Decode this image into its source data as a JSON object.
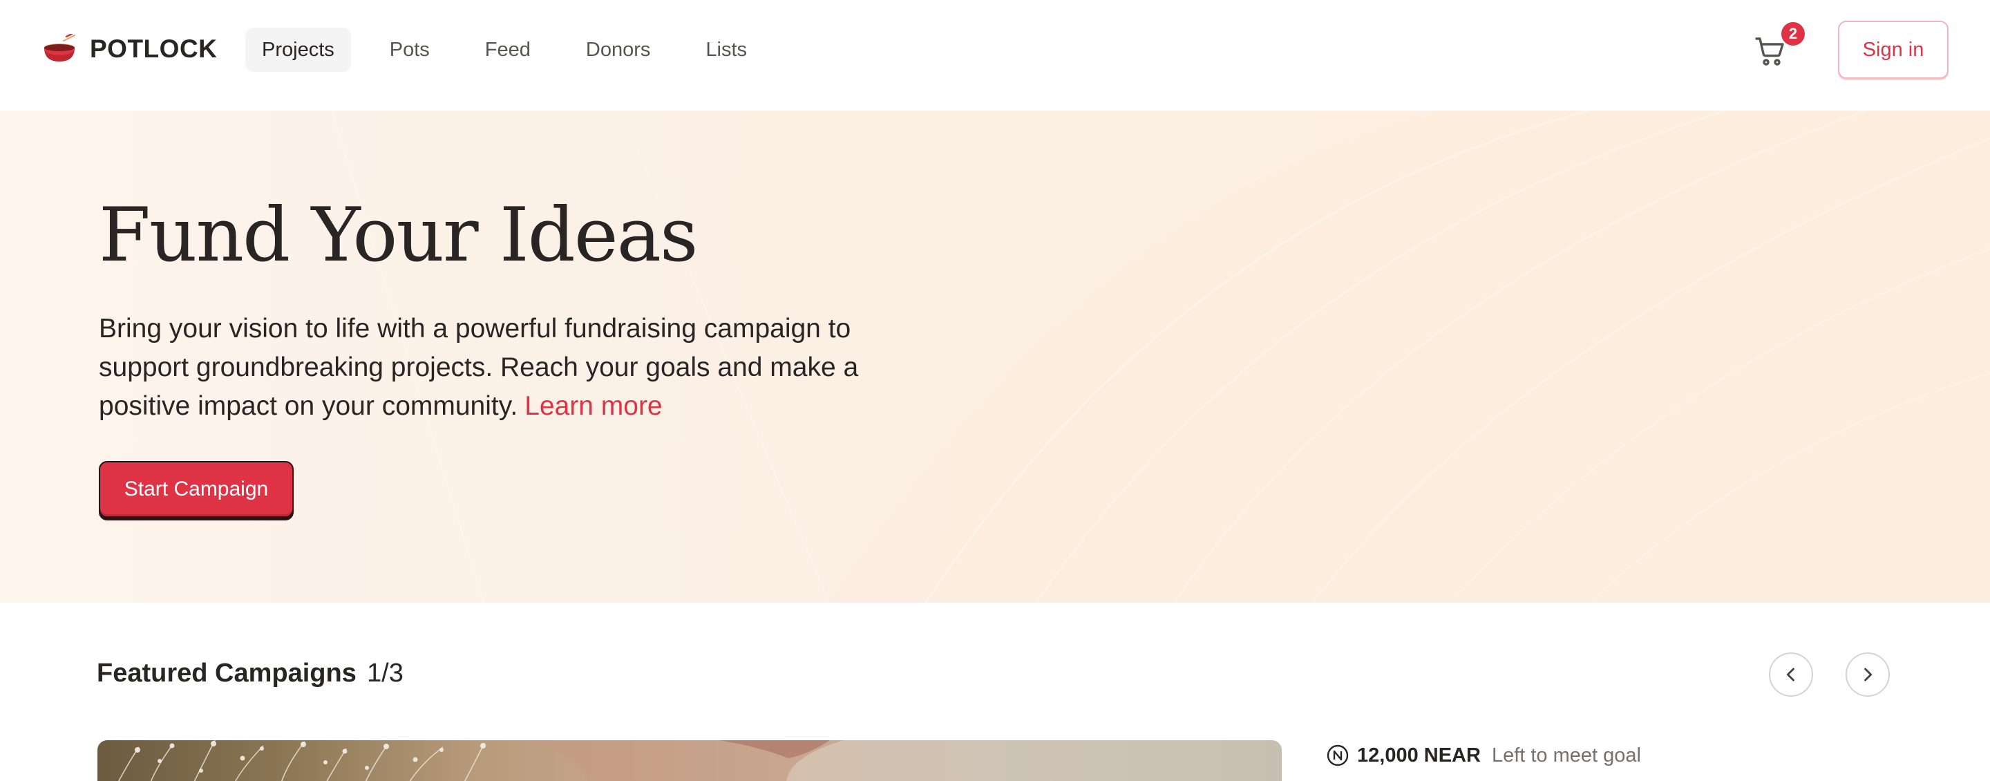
{
  "header": {
    "brand": "POTLOCK",
    "logo_icon": "pot-icon",
    "nav": [
      {
        "label": "Projects",
        "active": true
      },
      {
        "label": "Pots",
        "active": false
      },
      {
        "label": "Feed",
        "active": false
      },
      {
        "label": "Donors",
        "active": false
      },
      {
        "label": "Lists",
        "active": false
      }
    ],
    "cart": {
      "icon": "cart-icon",
      "count": "2"
    },
    "signin_label": "Sign in"
  },
  "hero": {
    "title": "Fund Your Ideas",
    "description": "Bring your vision to life with a powerful fundraising campaign to support groundbreaking projects. Reach your goals and make a positive impact on your community.",
    "learn_more": "Learn more",
    "cta_label": "Start Campaign"
  },
  "featured": {
    "title": "Featured Campaigns",
    "counter": "1/3",
    "prev_icon": "chevron-left-icon",
    "next_icon": "chevron-right-icon",
    "campaign": {
      "goal_icon": "near-icon",
      "goal_amount": "12,000 NEAR",
      "goal_label": "Left to meet goal"
    }
  },
  "colors": {
    "accent": "#dd3345",
    "hero_bg": "#fdf3ea",
    "text": "#292524",
    "muted": "#78716c"
  }
}
